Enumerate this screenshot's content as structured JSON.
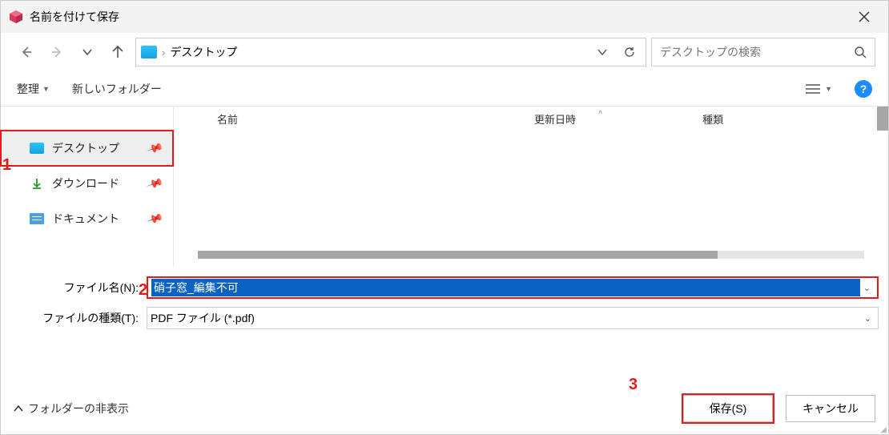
{
  "window": {
    "title": "名前を付けて保存"
  },
  "nav": {
    "breadcrumb": "デスクトップ",
    "search_placeholder": "デスクトップの検索"
  },
  "toolbar": {
    "organize": "整理",
    "newfolder": "新しいフォルダー"
  },
  "columns": {
    "name": "名前",
    "modified": "更新日時",
    "type": "種類"
  },
  "sidebar": {
    "items": [
      {
        "label": "デスクトップ",
        "icon": "desktop",
        "selected": true,
        "pinned": true
      },
      {
        "label": "ダウンロード",
        "icon": "download",
        "selected": false,
        "pinned": true
      },
      {
        "label": "ドキュメント",
        "icon": "document",
        "selected": false,
        "pinned": true
      }
    ]
  },
  "fields": {
    "filename_label": "ファイル名(N):",
    "filename_value": "硝子窓_編集不可",
    "filetype_label": "ファイルの種類(T):",
    "filetype_value": "PDF ファイル (*.pdf)"
  },
  "footer": {
    "hidefolders": "フォルダーの非表示",
    "save": "保存(S)",
    "cancel": "キャンセル"
  },
  "annotations": {
    "n1": "1",
    "n2": "2",
    "n3": "3"
  }
}
